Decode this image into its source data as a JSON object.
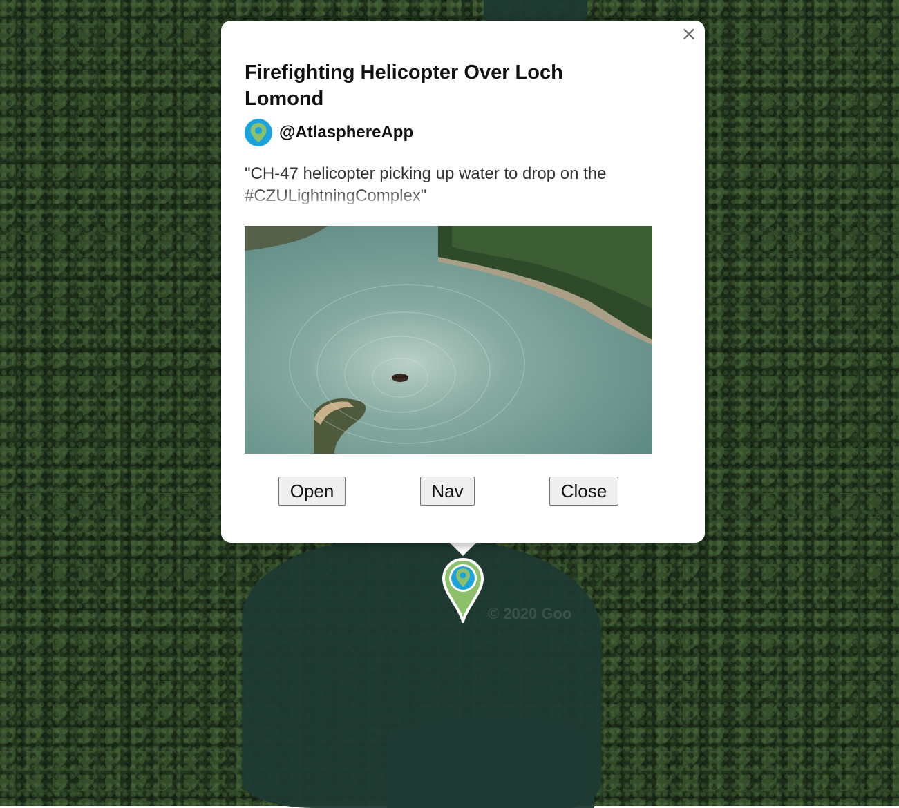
{
  "popup": {
    "title": "Firefighting Helicopter Over Loch Lomond",
    "author": {
      "handle": "@AtlasphereApp",
      "avatar_icon": "map-pin-icon",
      "avatar_color": "#1aa3dc"
    },
    "quote": "\"CH-47 helicopter picking up water to drop on the #CZULightningComplex\"",
    "close_icon": "close-icon",
    "buttons": {
      "open": "Open",
      "nav": "Nav",
      "close": "Close"
    }
  },
  "map": {
    "watermark": "© 2020 Goo",
    "marker_icon": "map-marker-icon",
    "marker_colors": {
      "outer": "#8dc06a",
      "inner": "#1aa3dc"
    }
  }
}
